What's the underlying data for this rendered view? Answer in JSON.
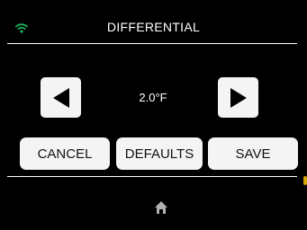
{
  "header": {
    "title": "DIFFERENTIAL",
    "wifi_icon": "wifi-icon",
    "wifi_color": "#19b35a"
  },
  "setting": {
    "value": "2.0°F",
    "decrease_icon": "arrow-left-icon",
    "increase_icon": "arrow-right-icon"
  },
  "actions": {
    "cancel_label": "CANCEL",
    "defaults_label": "DEFAULTS",
    "save_label": "SAVE"
  },
  "footer": {
    "home_icon": "home-icon",
    "home_color": "#b0b0b0"
  },
  "colors": {
    "background": "#000000",
    "button_face": "#f4f4f4",
    "text_light": "#ffffff"
  }
}
